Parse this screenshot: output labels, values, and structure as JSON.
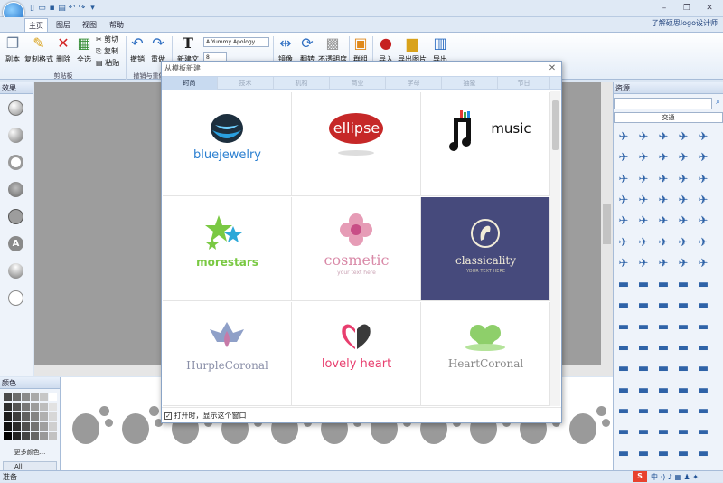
{
  "ribbon_tabs": [
    "主页",
    "图层",
    "视图",
    "帮助"
  ],
  "about": "了解硕思logo设计师",
  "ribbon": {
    "copy": "副本",
    "format_copy": "复制格式",
    "delete": "删除",
    "select_all": "全选",
    "cut": "剪切",
    "copy2": "复制",
    "paste": "粘贴",
    "clipboard_group": "剪贴板",
    "undo": "撤销",
    "redo": "重做",
    "undo_group": "撤销与重做",
    "new_text": "新建文字",
    "font_name": "A Yummy Apology",
    "font_size": "8",
    "mirror": "镜像",
    "rotate": "翻转",
    "opacity": "不透明度",
    "group": "群组",
    "import": "导入",
    "export_image": "导出图片",
    "export_svg": "导出SVG"
  },
  "left_panel": {
    "title": "效果"
  },
  "right_panel": {
    "title": "资源",
    "search_placeholder": "",
    "category": "交通",
    "icons": [
      "airplane-icon",
      "car-icon",
      "truck-icon",
      "bus-icon",
      "bicycle-icon"
    ]
  },
  "color_panel": {
    "title": "颜色",
    "more_colors": "更多颜色...",
    "all": "All",
    "swatches": [
      "#4a4a4a",
      "#6d6d6d",
      "#8a8a8a",
      "#a9a9a9",
      "#c7c7c7",
      "#ffffff",
      "#2e2e2e",
      "#555555",
      "#787878",
      "#9c9c9c",
      "#bdbdbd",
      "#e2e2e2",
      "#1d1d1d",
      "#3c3c3c",
      "#606060",
      "#848484",
      "#b0b0b0",
      "#d7d7d7",
      "#111111",
      "#2b2b2b",
      "#4f4f4f",
      "#737373",
      "#a0a0a0",
      "#cfcfcf",
      "#000000",
      "#222222",
      "#444444",
      "#666666",
      "#999999",
      "#c2c2c2"
    ]
  },
  "status": "准备",
  "dialog": {
    "title": "从模板新建",
    "tabs": [
      "时尚",
      "技术",
      "机构",
      "商业",
      "字母",
      "抽象",
      "节日"
    ],
    "active_tab": 0,
    "checkbox_label": "打开时，显示这个窗口",
    "checked": true,
    "templates": [
      {
        "name": "bluejewelry",
        "sub": ""
      },
      {
        "name": "ellipse",
        "sub": ""
      },
      {
        "name": "music",
        "sub": ""
      },
      {
        "name": "morestars",
        "sub": ""
      },
      {
        "name": "cosmetic",
        "sub": "your text here"
      },
      {
        "name": "classicality",
        "sub": "YOUR TEXT HERE"
      },
      {
        "name": "HurpleCoronal",
        "sub": ""
      },
      {
        "name": "lovely heart",
        "sub": ""
      },
      {
        "name": "HeartCoronal",
        "sub": ""
      }
    ]
  },
  "colors": {
    "accent": "#1d6fc9",
    "selected_cell": "#464a7c",
    "ribbon_bg": "#e4edf8"
  }
}
